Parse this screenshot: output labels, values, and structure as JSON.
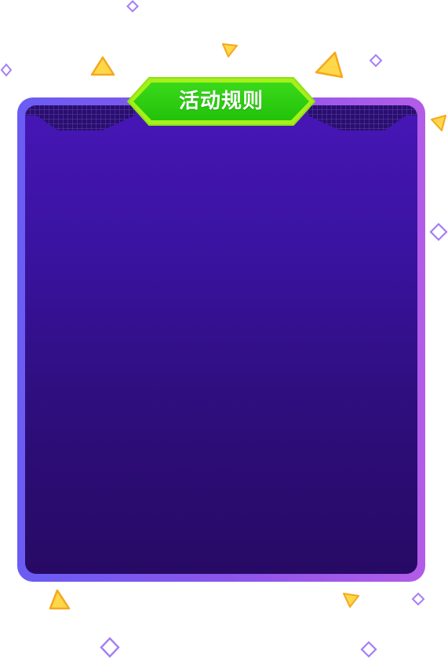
{
  "panel": {
    "title": "活动规则"
  },
  "colors": {
    "frame_border_left": "#6a5cf3",
    "frame_border_right": "#b25ce8",
    "panel_top": "#4716b6",
    "panel_bottom": "#270a65",
    "badge_fill": "#2ccc0c",
    "badge_stroke": "#a6f01a",
    "triangle_fill": "#ffd84a",
    "triangle_stroke": "#f4a81c",
    "diamond_stroke": "#a57ef4"
  },
  "decorations": {
    "triangle_icon": "triangle-icon",
    "diamond_icon": "diamond-icon"
  }
}
